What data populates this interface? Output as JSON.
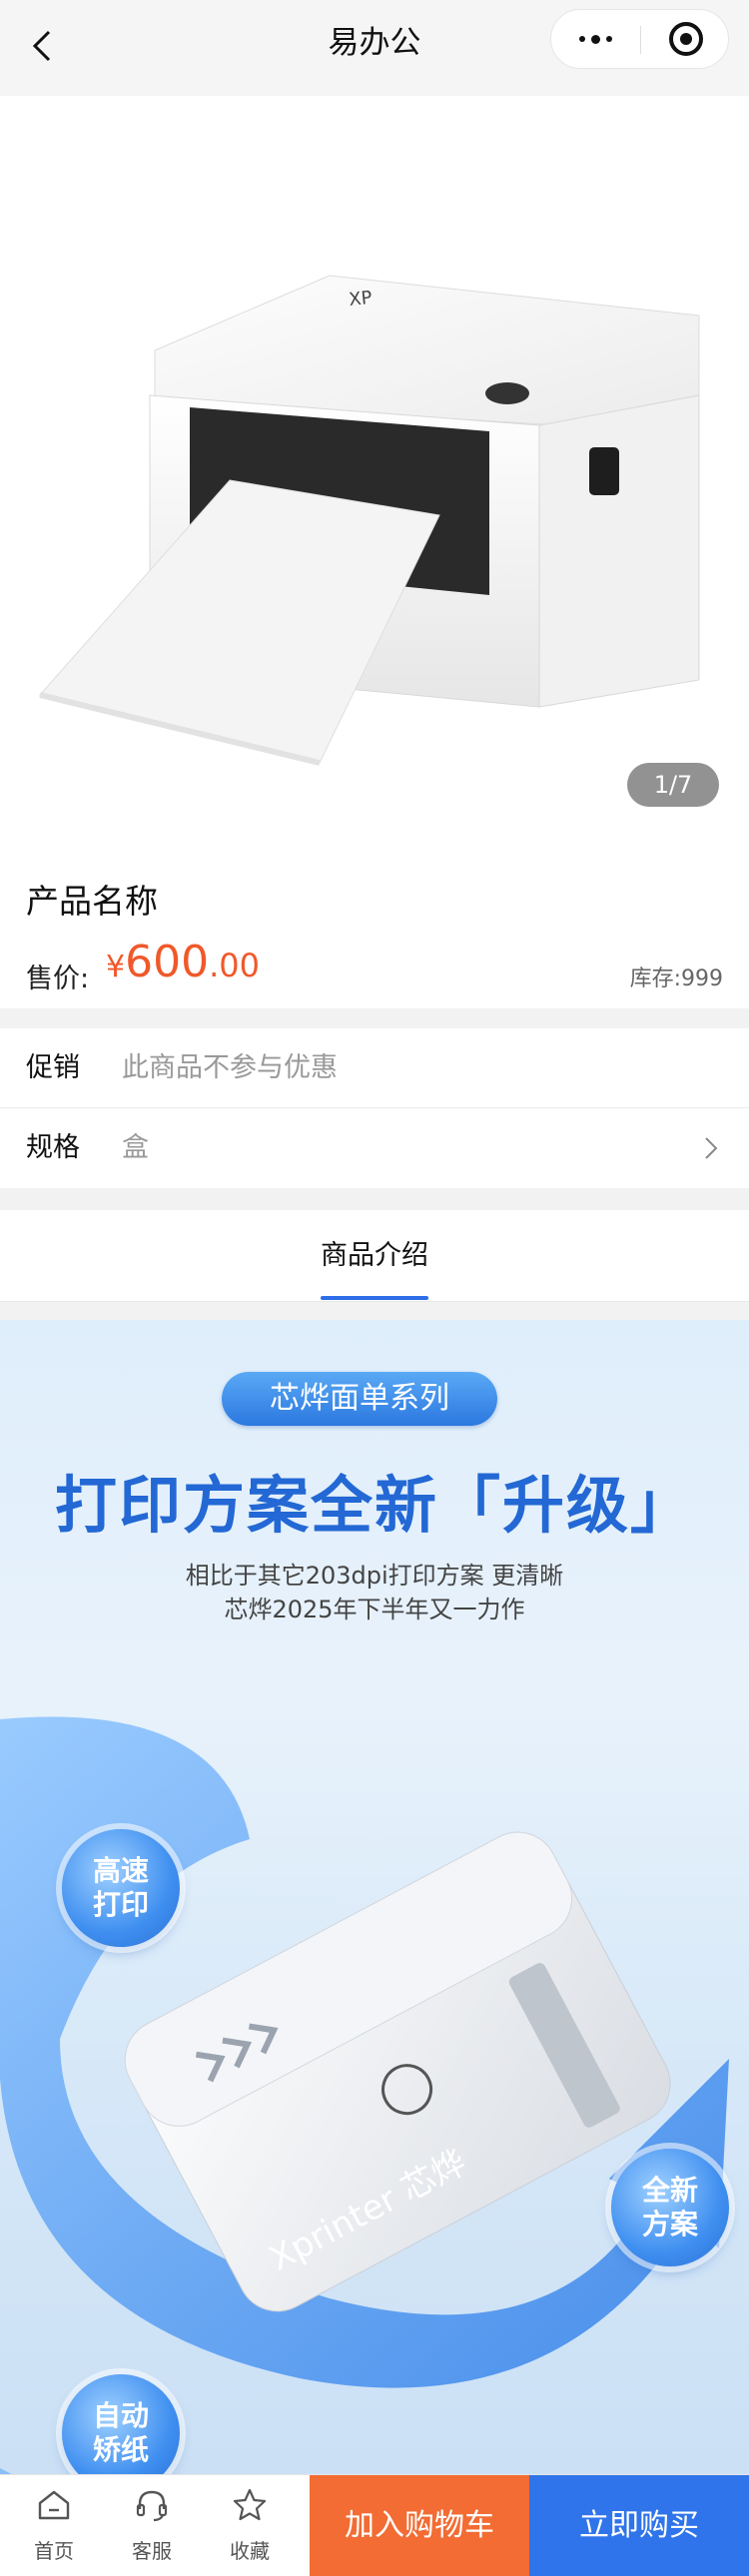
{
  "header": {
    "title": "易办公",
    "back_icon": "chevron-left-icon",
    "more_icon": "more-dots-icon",
    "close_icon": "target-circle-icon"
  },
  "gallery": {
    "indicator": "1/7"
  },
  "product": {
    "name": "产品名称",
    "price_label": "售价:",
    "currency": "¥",
    "price_int": "600",
    "price_dec": ".00",
    "stock_label": "库存:",
    "stock_value": "999",
    "price_color": "#f0582a"
  },
  "options": {
    "promo_label": "促销",
    "promo_value": "此商品不参与优惠",
    "spec_label": "规格",
    "spec_value": "盒"
  },
  "tabs": {
    "active": "商品介绍",
    "accent": "#2d6ee8"
  },
  "detail_banner": {
    "series": "芯烨面单系列",
    "headline": "打印方案全新「升级」",
    "line1": "相比于其它203dpi打印方案 更清晰",
    "line2": "芯烨2025年下半年又一力作",
    "badges": [
      {
        "line1": "高速",
        "line2": "打印"
      },
      {
        "line1": "全新",
        "line2": "方案"
      },
      {
        "line1": "自动",
        "line2": "矫纸"
      }
    ],
    "printer_brand": "Xprinter 芯烨"
  },
  "bottom_bar": {
    "nav": [
      {
        "label": "首页",
        "icon": "home-icon"
      },
      {
        "label": "客服",
        "icon": "headset-icon"
      },
      {
        "label": "收藏",
        "icon": "star-icon"
      }
    ],
    "add_cart": "加入购物车",
    "buy_now": "立即购买",
    "cart_color": "#f26c33",
    "buy_color": "#2f74ea"
  }
}
